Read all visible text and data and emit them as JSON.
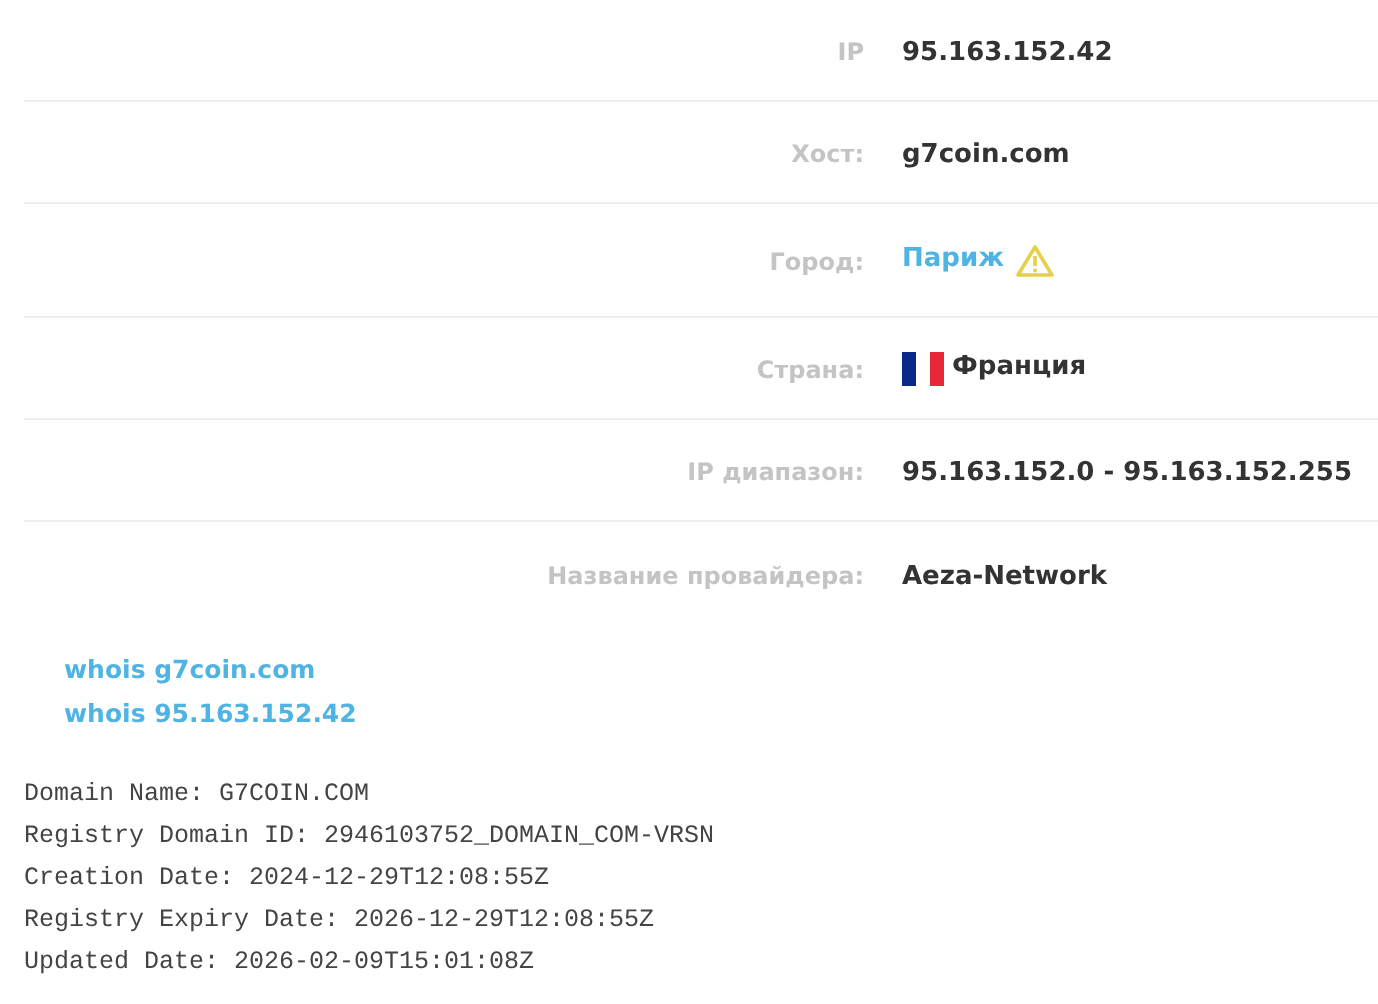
{
  "info_rows": [
    {
      "label": "IP",
      "kind": "text",
      "value": "95.163.152.42"
    },
    {
      "label": "Хост:",
      "kind": "text",
      "value": "g7coin.com"
    },
    {
      "label": "Город:",
      "kind": "link_warning",
      "value": "Париж"
    },
    {
      "label": "Страна:",
      "kind": "flag",
      "value": "Франция"
    },
    {
      "label": "IP диапазон:",
      "kind": "text",
      "value": "95.163.152.0 - 95.163.152.255"
    },
    {
      "label": "Название провайдера:",
      "kind": "text",
      "value": "Aeza-Network"
    }
  ],
  "whois_links": [
    "whois g7coin.com",
    "whois 95.163.152.42"
  ],
  "whois_output": [
    "Domain Name: G7COIN.COM",
    "Registry Domain ID: 2946103752_DOMAIN_COM-VRSN",
    "Creation Date: 2024-12-29T12:08:55Z",
    "Registry Expiry Date: 2026-12-29T12:08:55Z",
    "Updated Date: 2026-02-09T15:01:08Z"
  ]
}
